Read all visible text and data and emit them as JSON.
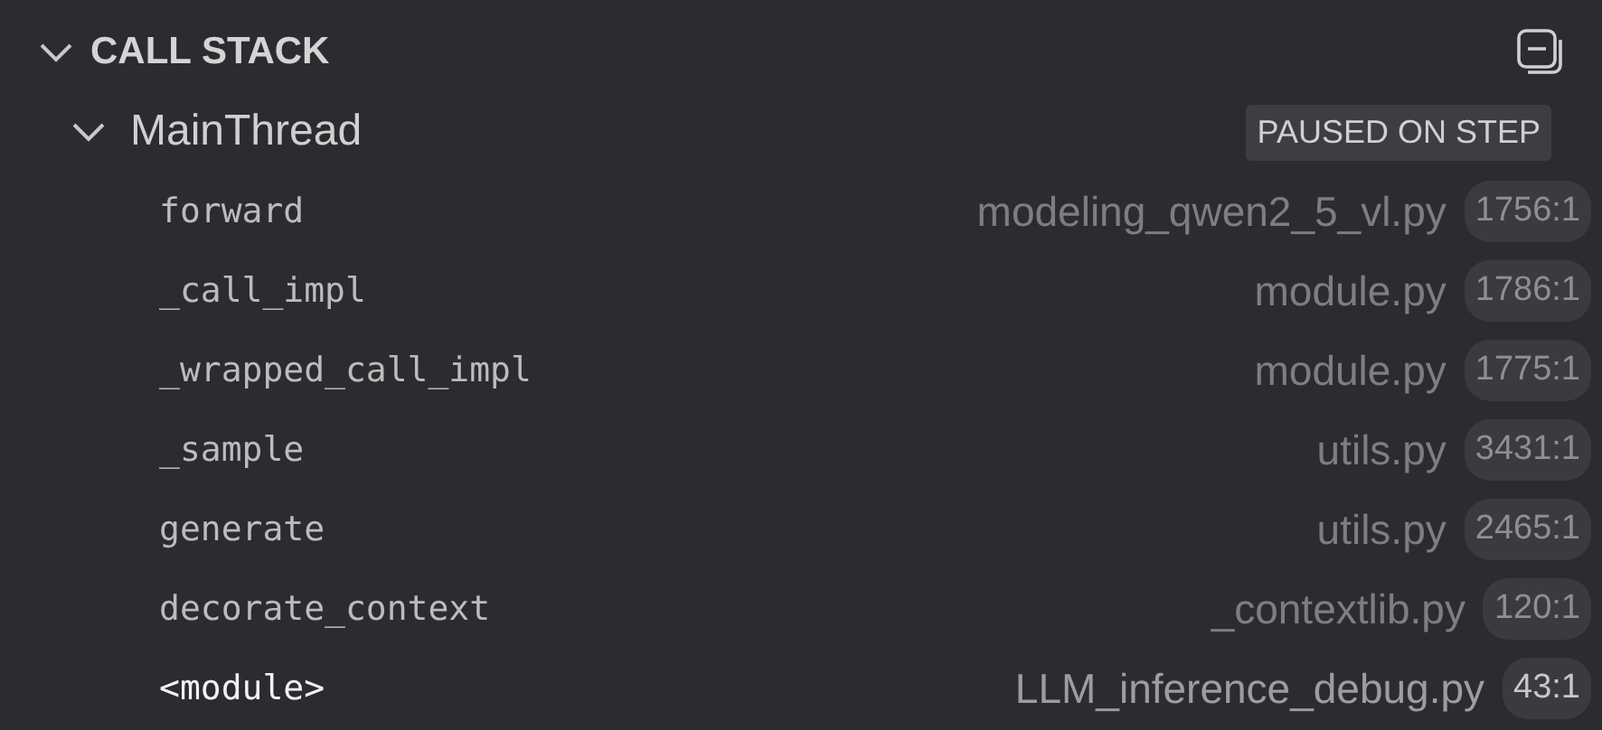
{
  "section": {
    "title": "CALL STACK",
    "expanded": true
  },
  "thread": {
    "name": "MainThread",
    "expanded": true,
    "status": "PAUSED ON STEP"
  },
  "frames": [
    {
      "function": "forward",
      "file": "modeling_qwen2_5_vl.py",
      "position": "1756:1",
      "selected": false
    },
    {
      "function": "_call_impl",
      "file": "module.py",
      "position": "1786:1",
      "selected": false
    },
    {
      "function": "_wrapped_call_impl",
      "file": "module.py",
      "position": "1775:1",
      "selected": false
    },
    {
      "function": "_sample",
      "file": "utils.py",
      "position": "3431:1",
      "selected": false
    },
    {
      "function": "generate",
      "file": "utils.py",
      "position": "2465:1",
      "selected": false
    },
    {
      "function": "decorate_context",
      "file": "_contextlib.py",
      "position": "120:1",
      "selected": false
    },
    {
      "function": "<module>",
      "file": "LLM_inference_debug.py",
      "position": "43:1",
      "selected": true
    }
  ]
}
